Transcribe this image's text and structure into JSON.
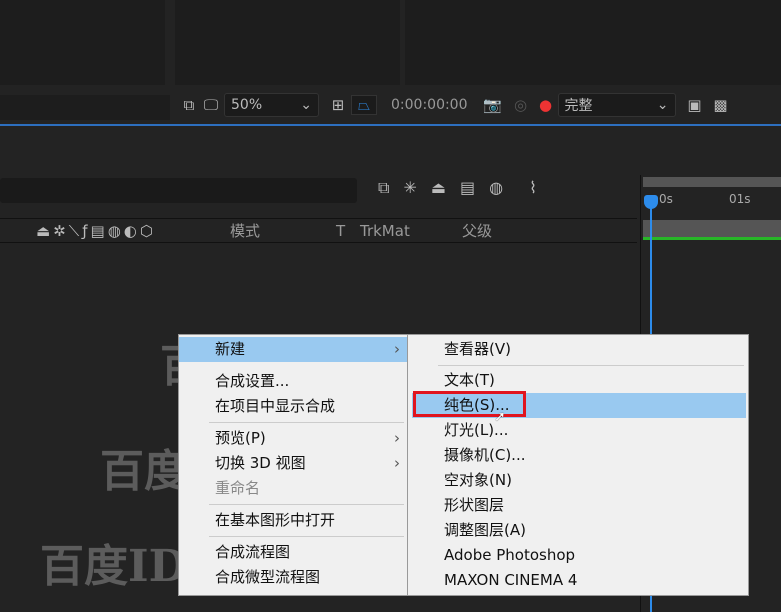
{
  "viewer_toolbar": {
    "zoom": "50%",
    "timecode": "0:00:00:00",
    "resolution": "完整"
  },
  "timeline": {
    "columns": {
      "mode": "模式",
      "t": "T",
      "trkmat": "TrkMat",
      "parent": "父级"
    },
    "ruler": [
      "0s",
      "01s"
    ]
  },
  "context_menu": {
    "items": [
      {
        "label": "新建",
        "submenu": true,
        "highlighted": true
      },
      {
        "label": "合成设置..."
      },
      {
        "label": "在项目中显示合成"
      },
      {
        "label": "预览(P)",
        "submenu": true
      },
      {
        "label": "切换 3D 视图",
        "submenu": true
      },
      {
        "label": "重命名",
        "disabled": true
      },
      {
        "label": "在基本图形中打开"
      },
      {
        "label": "合成流程图"
      },
      {
        "label": "合成微型流程图"
      }
    ]
  },
  "submenu": {
    "items": [
      {
        "label": "查看器(V)"
      },
      {
        "label": "文本(T)"
      },
      {
        "label": "纯色(S)...",
        "highlighted": true
      },
      {
        "label": "灯光(L)..."
      },
      {
        "label": "摄像机(C)..."
      },
      {
        "label": "空对象(N)"
      },
      {
        "label": "形状图层"
      },
      {
        "label": "调整图层(A)"
      },
      {
        "label": "Adobe Photoshop "
      },
      {
        "label": "MAXON CINEMA 4"
      }
    ]
  },
  "watermark": "百度ID: ffjczr",
  "colors": {
    "accent": "#2d8ceb",
    "highlight": "#99c9f0",
    "annotation": "#e0141e"
  }
}
